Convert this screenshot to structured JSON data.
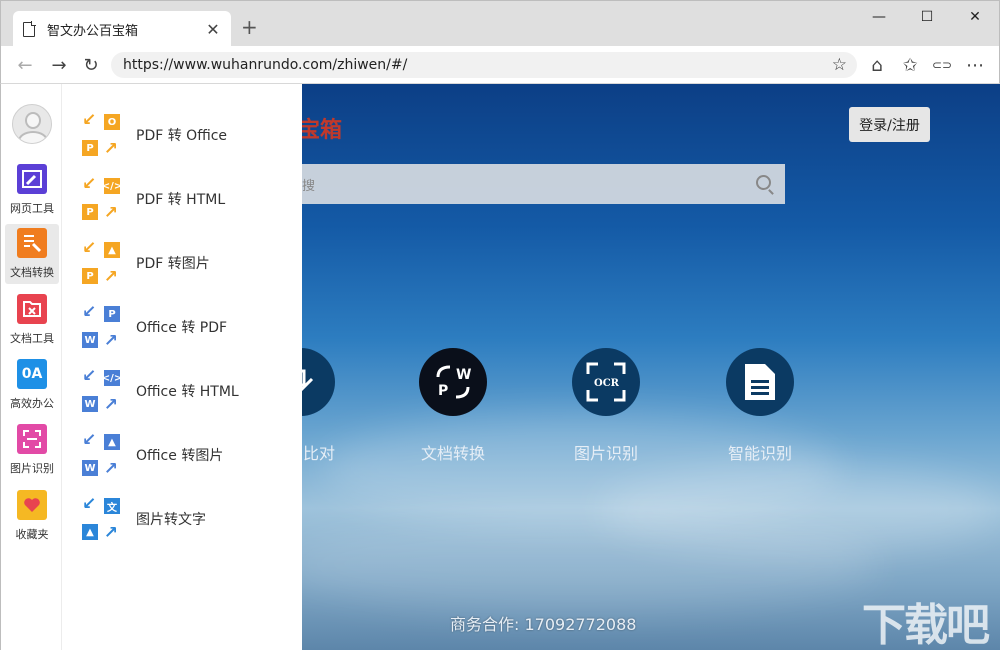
{
  "browser": {
    "tab_title": "智文办公百宝箱",
    "tab_close": "✕",
    "new_tab": "+",
    "url": "https://www.wuhanrundo.com/zhiwen/#/",
    "window_controls": {
      "minimize": "—",
      "maximize": "☐",
      "close": "✕"
    },
    "nav": {
      "back": "←",
      "forward": "→",
      "refresh": "↻"
    },
    "toolbar": {
      "favorite": "☆",
      "home": "⌂",
      "favorites_list": "✩",
      "share": "⊂⊃",
      "more": "⋯"
    }
  },
  "header": {
    "logo_text": "宝箱",
    "login_label": "登录/注册",
    "search_placeholder": "搜"
  },
  "sidebar": {
    "items": [
      {
        "label": "网页工具",
        "icon": "web-tool-icon",
        "color": "#5b3fd6"
      },
      {
        "label": "文档转换",
        "icon": "doc-convert-icon",
        "color": "#f07d1f",
        "active": true
      },
      {
        "label": "文档工具",
        "icon": "doc-tool-icon",
        "color": "#e8434f"
      },
      {
        "label": "高效办公",
        "icon": "office-icon",
        "color": "#1e90e6",
        "glyph": "0A"
      },
      {
        "label": "图片识别",
        "icon": "image-recognize-icon",
        "color": "#e24aa6"
      },
      {
        "label": "收藏夹",
        "icon": "favorites-icon",
        "color": "#f5b823"
      }
    ]
  },
  "panel": {
    "items": [
      {
        "label": "PDF 转 Office",
        "tr": "O",
        "bl": "P",
        "tr_color": "#f5a623",
        "bl_color": "#f5a623",
        "arrow_color": "#f5a623"
      },
      {
        "label": "PDF 转 HTML",
        "tr": "</>",
        "bl": "P",
        "tr_color": "#f5a623",
        "bl_color": "#f5a623",
        "arrow_color": "#f5a623"
      },
      {
        "label": "PDF 转图片",
        "tr": "▲",
        "bl": "P",
        "tr_color": "#f5a623",
        "bl_color": "#f5a623",
        "arrow_color": "#f5a623"
      },
      {
        "label": "Office 转 PDF",
        "tr": "P",
        "bl": "W",
        "tr_color": "#4a7fd6",
        "bl_color": "#4a7fd6",
        "arrow_color": "#4a7fd6"
      },
      {
        "label": "Office 转 HTML",
        "tr": "</>",
        "bl": "W",
        "tr_color": "#4a7fd6",
        "bl_color": "#4a7fd6",
        "arrow_color": "#4a7fd6"
      },
      {
        "label": "Office 转图片",
        "tr": "▲",
        "bl": "W",
        "tr_color": "#4a7fd6",
        "bl_color": "#4a7fd6",
        "arrow_color": "#4a7fd6"
      },
      {
        "label": "图片转文字",
        "tr": "文",
        "bl": "▲",
        "tr_color": "#2b86d9",
        "bl_color": "#2b86d9",
        "arrow_color": "#2b86d9"
      }
    ]
  },
  "features": [
    {
      "label": "比对",
      "icon": "compare-icon"
    },
    {
      "label": "文档转换",
      "icon": "doc-convert-icon",
      "glyph": "W P"
    },
    {
      "label": "图片识别",
      "icon": "ocr-icon",
      "glyph": "OCR"
    },
    {
      "label": "智能识别",
      "icon": "document-icon",
      "glyph": "≡"
    }
  ],
  "footer": {
    "text": "商务合作: 17092772088"
  },
  "watermark": "下载吧"
}
